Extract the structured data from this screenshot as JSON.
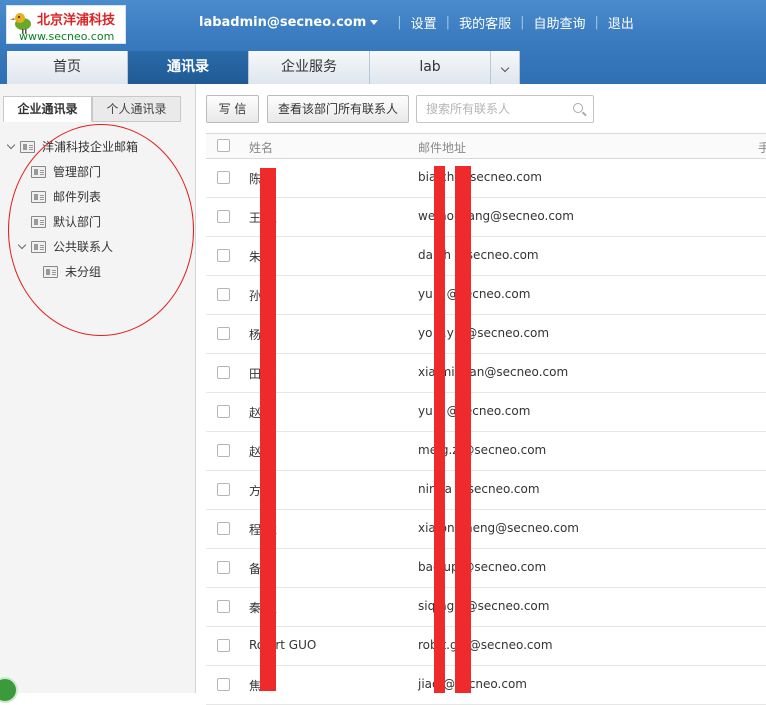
{
  "logo": {
    "company": "北京洋浦科技",
    "url": "www.secneo.com"
  },
  "topnav": {
    "email": "labadmin@secneo.com",
    "links": [
      "设置",
      "我的客服",
      "自助查询",
      "退出"
    ]
  },
  "tabs": [
    "首页",
    "通讯录",
    "企业服务",
    "lab"
  ],
  "sidebar": {
    "subtabs": [
      "企业通讯录",
      "个人通讯录"
    ],
    "tree": [
      "洋浦科技企业邮箱",
      "管理部门",
      "邮件列表",
      "默认部门",
      "公共联系人",
      "未分组"
    ]
  },
  "toolbar": {
    "write": "写 信",
    "view_all": "查看该部门所有联系人",
    "search_placeholder": "搜索所有联系人"
  },
  "table": {
    "headers": {
      "name": "姓名",
      "email": "邮件地址",
      "extra": "手"
    },
    "rows": [
      {
        "name": "陈",
        "email": "bia     ch     @secneo.com"
      },
      {
        "name": "王   红",
        "email": "we     ho     wang@secneo.com"
      },
      {
        "name": "朱",
        "email": "da     ch     @secneo.com"
      },
      {
        "name": "孙",
        "email": "yu.s     @secneo.com"
      },
      {
        "name": "杨   利",
        "email": "yo     li.y     g@secneo.com"
      },
      {
        "name": "田   宁",
        "email": "xia     min     ian@secneo.com"
      },
      {
        "name": "赵",
        "email": "yu.z     @secneo.com"
      },
      {
        "name": "赵",
        "email": "me     g.z     @secneo.com"
      },
      {
        "name": "方",
        "email": "nin     fa     @secneo.com"
      },
      {
        "name": "程   龙",
        "email": "xia     on     cheng@secneo.com"
      },
      {
        "name": "备",
        "email": "bac     up     @secneo.com"
      },
      {
        "name": "秦   强",
        "email": "siq     ng     n@secneo.com"
      },
      {
        "name": "Ro   ert GUO",
        "email": "rob     t.g     o@secneo.com"
      },
      {
        "name": "焦",
        "email": "jiao     @secneo.com"
      }
    ]
  }
}
